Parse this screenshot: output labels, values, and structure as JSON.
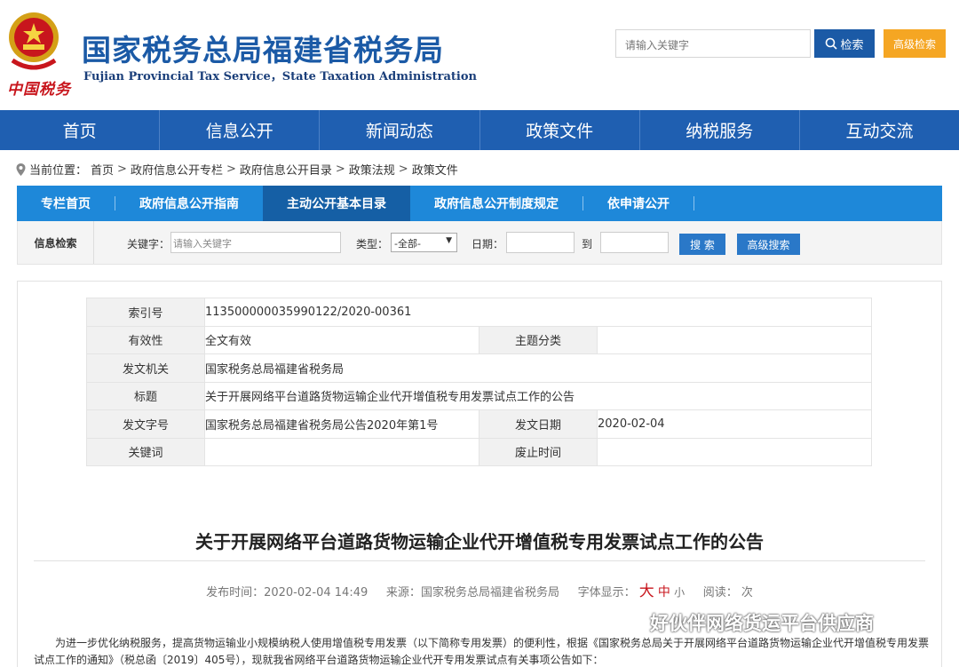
{
  "header": {
    "title": "国家税务总局福建省税务局",
    "subtitle": "Fujian Provincial Tax Service，State Taxation Administration",
    "brand_script": "中国税务",
    "search_placeholder": "请输入关键字",
    "search_label": "检索",
    "advanced_label": "高级检索"
  },
  "main_nav": [
    "首页",
    "信息公开",
    "新闻动态",
    "政策文件",
    "纳税服务",
    "互动交流"
  ],
  "breadcrumb": {
    "prefix": "当前位置：",
    "items": [
      "首页",
      "政府信息公开专栏",
      "政府信息公开目录",
      "政策法规",
      "政策文件"
    ]
  },
  "sub_nav": [
    "专栏首页",
    "政府信息公开指南",
    "主动公开基本目录",
    "政府信息公开制度规定",
    "依申请公开"
  ],
  "info_search": {
    "label": "信息检索",
    "keyword_label": "关键字：",
    "keyword_placeholder": "请输入关键字",
    "type_label": "类型：",
    "type_value": "-全部-",
    "date_label": "日期：",
    "to_label": "到",
    "search_label": "搜 索",
    "advanced_label": "高级搜索"
  },
  "meta": {
    "index_label": "索引号",
    "index_value": "113500000035990122/2020-00361",
    "validity_label": "有效性",
    "validity_value": "全文有效",
    "topic_label": "主题分类",
    "topic_value": "",
    "issuer_label": "发文机关",
    "issuer_value": "国家税务总局福建省税务局",
    "title_label": "标题",
    "title_value": "关于开展网络平台道路货物运输企业代开增值税专用发票试点工作的公告",
    "docno_label": "发文字号",
    "docno_value": "国家税务总局福建省税务局公告2020年第1号",
    "date_label": "发文日期",
    "date_value": "2020-02-04",
    "keywords_label": "关键词",
    "keywords_value": "",
    "expiry_label": "废止时间",
    "expiry_value": ""
  },
  "article": {
    "title": "关于开展网络平台道路货物运输企业代开增值税专用发票试点工作的公告",
    "publish_label": "发布时间：",
    "publish_time": "2020-02-04 14:49",
    "source_label": "来源：",
    "source": "国家税务总局福建省税务局",
    "font_label": "字体显示：",
    "font_big": "大",
    "font_mid": "中",
    "font_small": "小",
    "reads_label": "阅读：",
    "reads_unit": "次",
    "body": "为进一步优化纳税服务，提高货物运输业小规模纳税人使用增值税专用发票（以下简称专用发票）的便利性，根据《国家税务总局关于开展网络平台道路货物运输企业代开增值税专用发票试点工作的通知》（税总函〔2019〕405号），现就我省网络平台道路货物运输企业代开专用发票试点有关事项公告如下："
  },
  "watermark": "好伙伴网络货运平台供应商",
  "colors": {
    "primary": "#1f5fb1",
    "accent": "#f5a623",
    "sub_nav": "#1e88d9",
    "brand_red": "#c8161d"
  }
}
